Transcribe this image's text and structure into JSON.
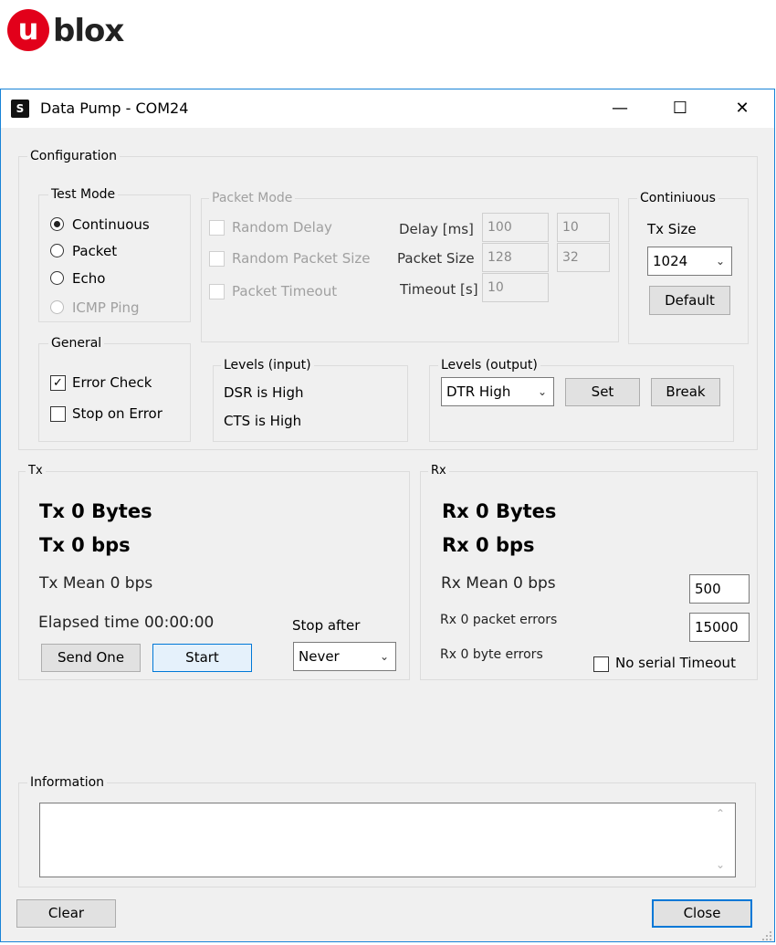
{
  "logo": {
    "mark": "u",
    "text": "blox"
  },
  "window": {
    "title": "Data Pump - COM24",
    "app_icon": "S",
    "minimize": "—",
    "maximize": "☐",
    "close": "✕"
  },
  "configuration": {
    "legend": "Configuration",
    "test_mode": {
      "legend": "Test Mode",
      "options": [
        "Continuous",
        "Packet",
        "Echo",
        "ICMP Ping"
      ],
      "selected": "Continuous"
    },
    "packet_mode": {
      "legend": "Packet Mode",
      "random_delay": "Random Delay",
      "random_packet_size": "Random Packet Size",
      "packet_timeout": "Packet Timeout",
      "delay_label": "Delay [ms]",
      "delay_min": "100",
      "delay_max": "10",
      "packet_size_label": "Packet Size",
      "packet_size_min": "128",
      "packet_size_max": "32",
      "timeout_label": "Timeout [s]",
      "timeout_value": "10"
    },
    "continuous": {
      "legend": "Continiuous",
      "tx_size_label": "Tx Size",
      "tx_size_value": "1024",
      "default_button": "Default"
    },
    "general": {
      "legend": "General",
      "error_check": "Error Check",
      "error_check_checked": true,
      "stop_on_error": "Stop on Error",
      "stop_on_error_checked": false
    },
    "levels_input": {
      "legend": "Levels (input)",
      "dsr": "DSR is High",
      "cts": "CTS is High"
    },
    "levels_output": {
      "legend": "Levels (output)",
      "dtr_value": "DTR High",
      "set_button": "Set",
      "break_button": "Break"
    }
  },
  "tx": {
    "legend": "Tx",
    "bytes": "Tx 0 Bytes",
    "bps": "Tx 0 bps",
    "mean": "Tx Mean 0 bps",
    "elapsed": "Elapsed time 00:00:00",
    "stop_after_label": "Stop after",
    "stop_after_value": "Never",
    "send_one_button": "Send One",
    "start_button": "Start"
  },
  "rx": {
    "legend": "Rx",
    "bytes": "Rx 0 Bytes",
    "bps": "Rx 0 bps",
    "mean": "Rx Mean 0 bps",
    "packet_errors": "Rx 0 packet errors",
    "byte_errors": "Rx 0 byte errors",
    "field1": "500",
    "field2": "15000",
    "no_serial_timeout": "No serial Timeout"
  },
  "information": {
    "legend": "Information",
    "text": ""
  },
  "footer": {
    "clear_button": "Clear",
    "close_button": "Close"
  }
}
